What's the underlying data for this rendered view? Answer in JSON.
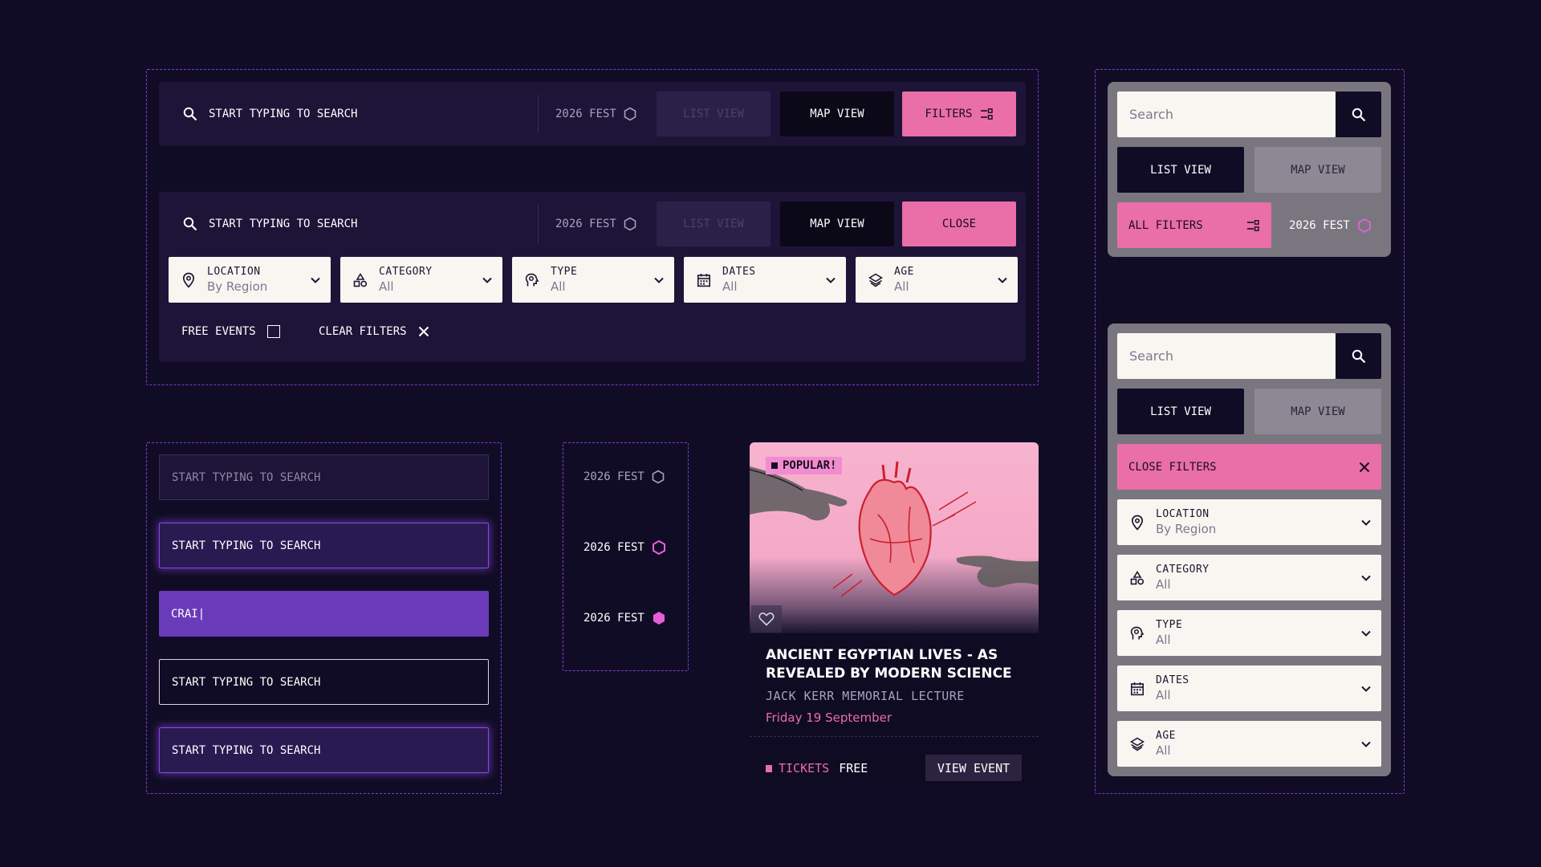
{
  "search_bar": {
    "placeholder": "START TYPING TO SEARCH",
    "fest": "2026 FEST",
    "list_view": "LIST VIEW",
    "map_view": "MAP VIEW",
    "filters": "FILTERS",
    "close": "CLOSE"
  },
  "filters": {
    "location": {
      "label": "LOCATION",
      "value": "By Region"
    },
    "category": {
      "label": "CATEGORY",
      "value": "All"
    },
    "type": {
      "label": "TYPE",
      "value": "All"
    },
    "dates": {
      "label": "DATES",
      "value": "All"
    },
    "age": {
      "label": "AGE",
      "value": "All"
    },
    "free_events": "FREE EVENTS",
    "clear_filters": "CLEAR FILTERS"
  },
  "inputs": {
    "placeholder": "START TYPING TO SEARCH",
    "typed_value": "CRAI|"
  },
  "fest_states": [
    "2026 FEST",
    "2026 FEST",
    "2026 FEST"
  ],
  "event_card": {
    "badge": "POPULAR!",
    "title": "ANCIENT EGYPTIAN LIVES - AS REVEALED BY MODERN SCIENCE",
    "subtitle": "JACK KERR MEMORIAL LECTURE",
    "date": "Friday 19 September",
    "tickets_label": "TICKETS",
    "tickets_value": "FREE",
    "view_event": "VIEW EVENT"
  },
  "mobile": {
    "search_placeholder": "Search",
    "list_view": "LIST VIEW",
    "map_view": "MAP VIEW",
    "all_filters": "ALL FILTERS",
    "fest": "2026 FEST",
    "close_filters": "CLOSE FILTERS"
  },
  "colors": {
    "background": "#110c25",
    "accent_pink": "#ea6ea8",
    "accent_purple": "#6a3bb8",
    "dashed_border": "#7f3cd8"
  }
}
